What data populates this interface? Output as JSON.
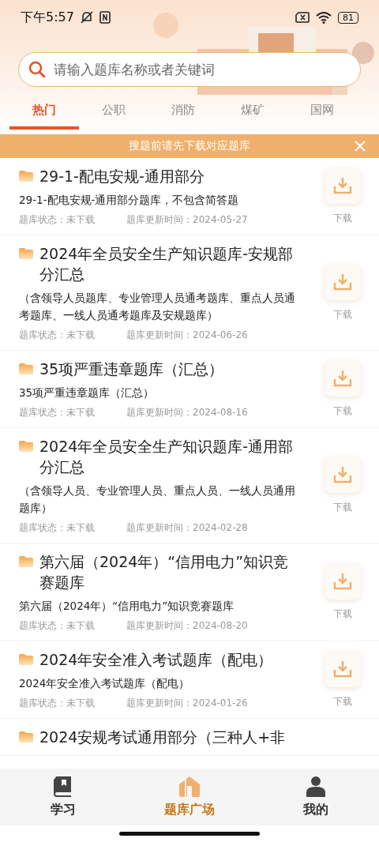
{
  "status_bar": {
    "time": "下午5:57",
    "battery": "81"
  },
  "search": {
    "placeholder": "请输入题库名称或者关键词"
  },
  "tabs": [
    {
      "label": "热门",
      "selected": true
    },
    {
      "label": "公职",
      "selected": false
    },
    {
      "label": "消防",
      "selected": false
    },
    {
      "label": "煤矿",
      "selected": false
    },
    {
      "label": "国网",
      "selected": false
    }
  ],
  "notice": {
    "text": "搜题前请先下载对应题库"
  },
  "banks": [
    {
      "title": "29-1-配电安规-通用部分",
      "description": "29-1-配电安规-通用部分题库，不包含简答题",
      "status": "题库状态：未下载",
      "updated": "题库更新时间：2024-05-27",
      "action": "下载"
    },
    {
      "title": "2024年全员安全生产知识题库-安规部分汇总",
      "description": "（含领导人员题库、专业管理人员通考题库、重点人员通考题库、一线人员通考题库及安规题库）",
      "status": "题库状态：未下载",
      "updated": "题库更新时间：2024-06-26",
      "action": "下载"
    },
    {
      "title": "35项严重违章题库（汇总）",
      "description": "35项严重违章题库（汇总）",
      "status": "题库状态：未下载",
      "updated": "题库更新时间：2024-08-16",
      "action": "下载"
    },
    {
      "title": "2024年全员安全生产知识题库-通用部分汇总",
      "description": "（含领导人员、专业管理人员、重点人员、一线人员通用题库）",
      "status": "题库状态：未下载",
      "updated": "题库更新时间：2024-02-28",
      "action": "下载"
    },
    {
      "title": "第六届（2024年）“信用电力”知识竞赛题库",
      "description": "第六届（2024年）“信用电力”知识竞赛题库",
      "status": "题库状态：未下载",
      "updated": "题库更新时间：2024-08-20",
      "action": "下载"
    },
    {
      "title": "2024年安全准入考试题库（配电）",
      "description": "2024年安全准入考试题库（配电）",
      "status": "题库状态：未下载",
      "updated": "题库更新时间：2024-01-26",
      "action": "下载"
    },
    {
      "title": "2024安规考试通用部分（三种人+非"
    }
  ],
  "bottom_nav": [
    {
      "label": "学习",
      "kind": "study",
      "selected": false
    },
    {
      "label": "题库广场",
      "kind": "square",
      "selected": true
    },
    {
      "label": "我的",
      "kind": "profile",
      "selected": false
    }
  ]
}
